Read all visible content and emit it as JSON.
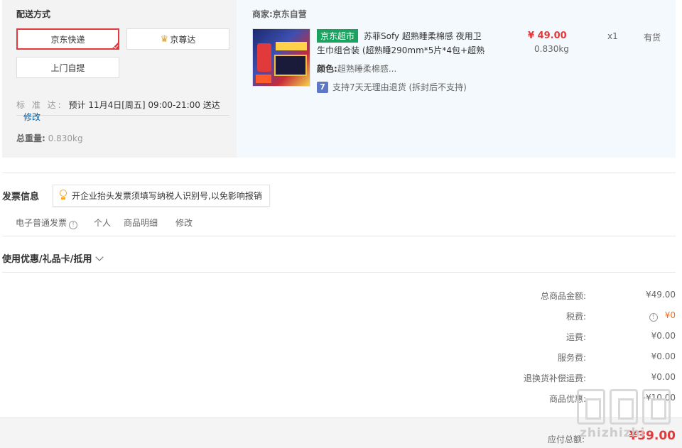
{
  "shipping": {
    "title": "配送方式",
    "options": [
      {
        "label": "京东快递",
        "selected": true
      },
      {
        "label": "京尊达",
        "selected": false,
        "icon": "crown-icon"
      },
      {
        "label": "上门自提",
        "selected": false
      }
    ],
    "standard_label": "标 准 达:",
    "standard_value": "预计 11月4日[周五] 09:00-21:00 送达",
    "modify": "修改",
    "weight_label": "总重量:",
    "weight_value": "0.830kg"
  },
  "items": {
    "merchant": "商家:京东自营",
    "product": {
      "badge": "京东超市",
      "name": "苏菲Sofy 超熟睡柔棉感 夜用卫生巾组合装 (超熟睡290mm*5片*4包+超熟",
      "color_label": "颜色:",
      "color_value": "超熟睡柔棉感...",
      "return_icon": "7",
      "return_text": "支持7天无理由退货 (拆封后不支持)",
      "price": "¥ 49.00",
      "weight": "0.830kg",
      "qty": "x1",
      "stock": "有货"
    }
  },
  "invoice": {
    "title": "发票信息",
    "tip": "开企业抬头发票须填写纳税人识别号,以免影响报销",
    "type": "电子普通发票",
    "holder": "个人",
    "content": "商品明细",
    "modify": "修改"
  },
  "coupon": {
    "title": "使用优惠/礼品卡/抵用"
  },
  "summary": {
    "rows": [
      {
        "label": "总商品金额:",
        "value": "¥49.00"
      },
      {
        "label": "税费:",
        "value": "¥0"
      },
      {
        "label": "运费:",
        "value": "¥0.00"
      },
      {
        "label": "服务费:",
        "value": "¥0.00"
      },
      {
        "label": "退换货补偿运费:",
        "value": "¥0.00"
      },
      {
        "label": "商品优惠:",
        "value": "-¥10.00"
      }
    ],
    "payable_label": "应付总额:",
    "payable_value": "¥39.00"
  },
  "watermark": {
    "text": "zhizhizhi"
  },
  "colors": {
    "accent_red": "#e4393c",
    "link_blue": "#005aa0",
    "badge_green": "#1aa260",
    "tax_orange": "#f56d1a"
  }
}
